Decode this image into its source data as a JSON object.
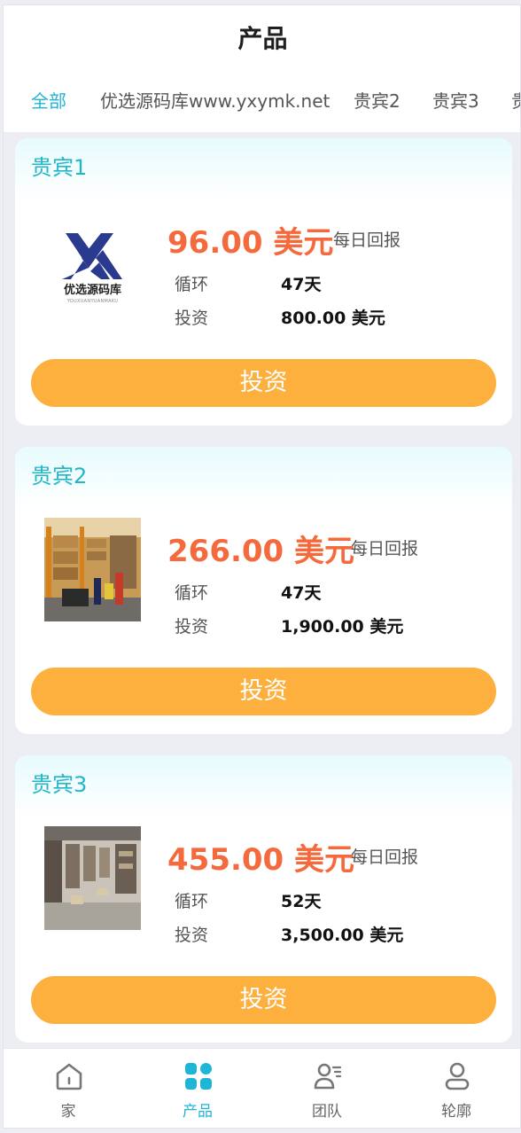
{
  "header": {
    "title": "产品",
    "tabs": [
      {
        "label": "全部",
        "active": true
      },
      {
        "label": "优选源码库www.yxymk.net",
        "active": false
      },
      {
        "label": "贵宾2",
        "active": false
      },
      {
        "label": "贵宾3",
        "active": false
      },
      {
        "label": "贵",
        "active": false
      }
    ]
  },
  "colors": {
    "accent": "#1eb6d6",
    "price": "#f46a3c",
    "button": "#fdb03e",
    "card_title": "#21b7c9"
  },
  "products": [
    {
      "name": "贵宾1",
      "price": "96.00 美元",
      "daily_label": "每日回报",
      "cycle_label": "循环",
      "cycle_value": "47天",
      "invest_label": "投资",
      "invest_value": "800.00 美元",
      "button_label": "投资",
      "image": {
        "type": "logo",
        "logo_text": "优选源码库",
        "logo_subtext": "YOUXUANYUANMAKU"
      }
    },
    {
      "name": "贵宾2",
      "price": "266.00 美元",
      "daily_label": "每日回报",
      "cycle_label": "循环",
      "cycle_value": "47天",
      "invest_label": "投资",
      "invest_value": "1,900.00 美元",
      "button_label": "投资",
      "image": {
        "type": "warehouse-photo"
      }
    },
    {
      "name": "贵宾3",
      "price": "455.00 美元",
      "daily_label": "每日回报",
      "cycle_label": "循环",
      "cycle_value": "52天",
      "invest_label": "投资",
      "invest_value": "3,500.00 美元",
      "button_label": "投资",
      "image": {
        "type": "storage-photo"
      }
    }
  ],
  "bottom_nav": [
    {
      "label": "家",
      "icon": "home-icon",
      "active": false
    },
    {
      "label": "产品",
      "icon": "products-icon",
      "active": true
    },
    {
      "label": "团队",
      "icon": "team-icon",
      "active": false
    },
    {
      "label": "轮廓",
      "icon": "profile-icon",
      "active": false
    }
  ]
}
